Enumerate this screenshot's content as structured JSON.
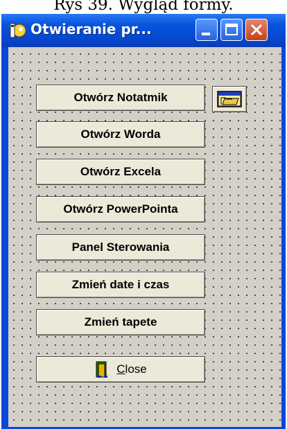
{
  "caption": "Rys 39. Wygląd formy.",
  "window": {
    "title": "Otwieranie pr...",
    "controls": [
      "minimize-icon",
      "maximize-icon",
      "close-icon"
    ]
  },
  "buttons": {
    "notatnik": "Otwórz Notatmik",
    "word": "Otwórz Worda",
    "excel": "Otwórz Excela",
    "powerpoint": "Otwórz PowerPointa",
    "panel": "Panel Sterowania",
    "date": "Zmień date i czas",
    "tapeta": "Zmień tapete",
    "close": "Close"
  },
  "icons": {
    "folder": "open-folder-icon",
    "door": "exit-door-icon",
    "app": "delphi-app-icon"
  }
}
